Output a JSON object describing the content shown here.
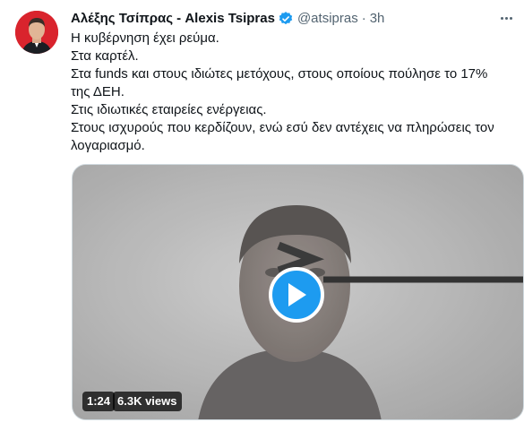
{
  "tweet": {
    "author": {
      "display_name": "Αλέξης Τσίπρας - Alexis Tsipras",
      "handle": "@atsipras",
      "verified_icon": "verified-badge-icon",
      "avatar_icon": "avatar-photo"
    },
    "separator": "·",
    "time": "3h",
    "more_icon": "more-options-icon",
    "text_lines": [
      "Η κυβέρνηση έχει ρεύμα.",
      "Στα καρτέλ.",
      "Στα funds και στους ιδιώτες μετόχους, στους οποίους πούλησε το 17% της ΔΕΗ.",
      "Στις ιδιωτικές εταιρείες ενέργειας.",
      "Στους ισχυρούς που κερδίζουν, ενώ εσύ δεν αντέχεις να πληρώσεις τον λογαριασμό."
    ],
    "video": {
      "play_icon": "play-icon",
      "duration": "1:24",
      "views": "6.3K views"
    }
  },
  "colors": {
    "accent": "#1d9bf0",
    "secondary_text": "#536471",
    "avatar_bg": "#d9242d"
  }
}
